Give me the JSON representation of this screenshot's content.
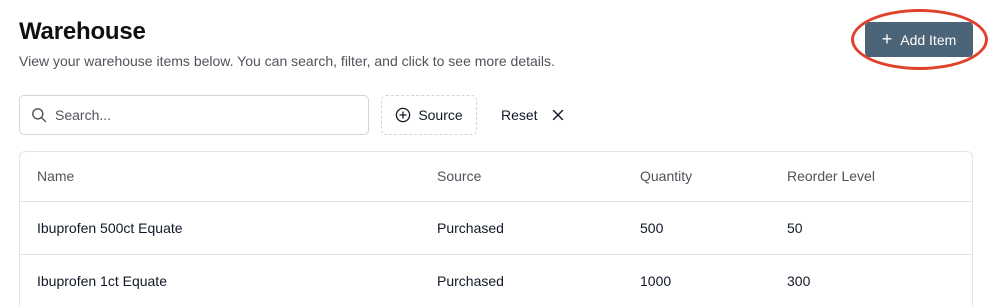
{
  "header": {
    "title": "Warehouse",
    "subtitle": "View your warehouse items below. You can search, filter, and click to see more details.",
    "add_label": "Add Item"
  },
  "toolbar": {
    "search_placeholder": "Search...",
    "source_label": "Source",
    "reset_label": "Reset"
  },
  "table": {
    "columns": [
      "Name",
      "Source",
      "Quantity",
      "Reorder Level"
    ],
    "rows": [
      [
        "Ibuprofen 500ct Equate",
        "Purchased",
        "500",
        "50"
      ],
      [
        "Ibuprofen 1ct Equate",
        "Purchased",
        "1000",
        "300"
      ]
    ]
  },
  "colors": {
    "accent": "#4c6478",
    "highlight": "#e0412b"
  },
  "icons": [
    "plus-icon",
    "search-icon",
    "plus-circle-icon",
    "close-icon"
  ]
}
